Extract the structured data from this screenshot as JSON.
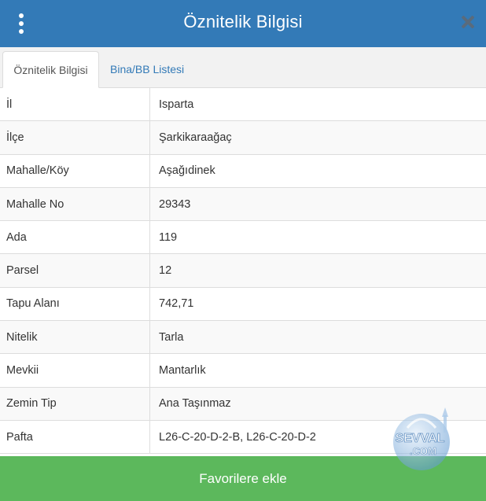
{
  "header": {
    "title": "Öznitelik Bilgisi"
  },
  "tabs": [
    {
      "label": "Öznitelik Bilgisi",
      "active": true
    },
    {
      "label": "Bina/BB Listesi",
      "active": false
    }
  ],
  "rows": [
    {
      "key": "İl",
      "value": "Isparta"
    },
    {
      "key": "İlçe",
      "value": "Şarkikaraağaç"
    },
    {
      "key": "Mahalle/Köy",
      "value": "Aşağıdinek"
    },
    {
      "key": "Mahalle No",
      "value": "29343"
    },
    {
      "key": "Ada",
      "value": "119"
    },
    {
      "key": "Parsel",
      "value": "12"
    },
    {
      "key": "Tapu Alanı",
      "value": "742,71"
    },
    {
      "key": "Nitelik",
      "value": "Tarla"
    },
    {
      "key": "Mevkii",
      "value": "Mantarlık"
    },
    {
      "key": "Zemin Tip",
      "value": "Ana Taşınmaz"
    },
    {
      "key": "Pafta",
      "value": "L26-C-20-D-2-B, L26-C-20-D-2"
    }
  ],
  "footer": {
    "button_label": "Favorilere ekle"
  },
  "watermark": {
    "line1": "SEVVAL",
    "line2": ".COM"
  },
  "colors": {
    "header": "#337ab7",
    "button": "#5cb85c",
    "link": "#337ab7"
  }
}
